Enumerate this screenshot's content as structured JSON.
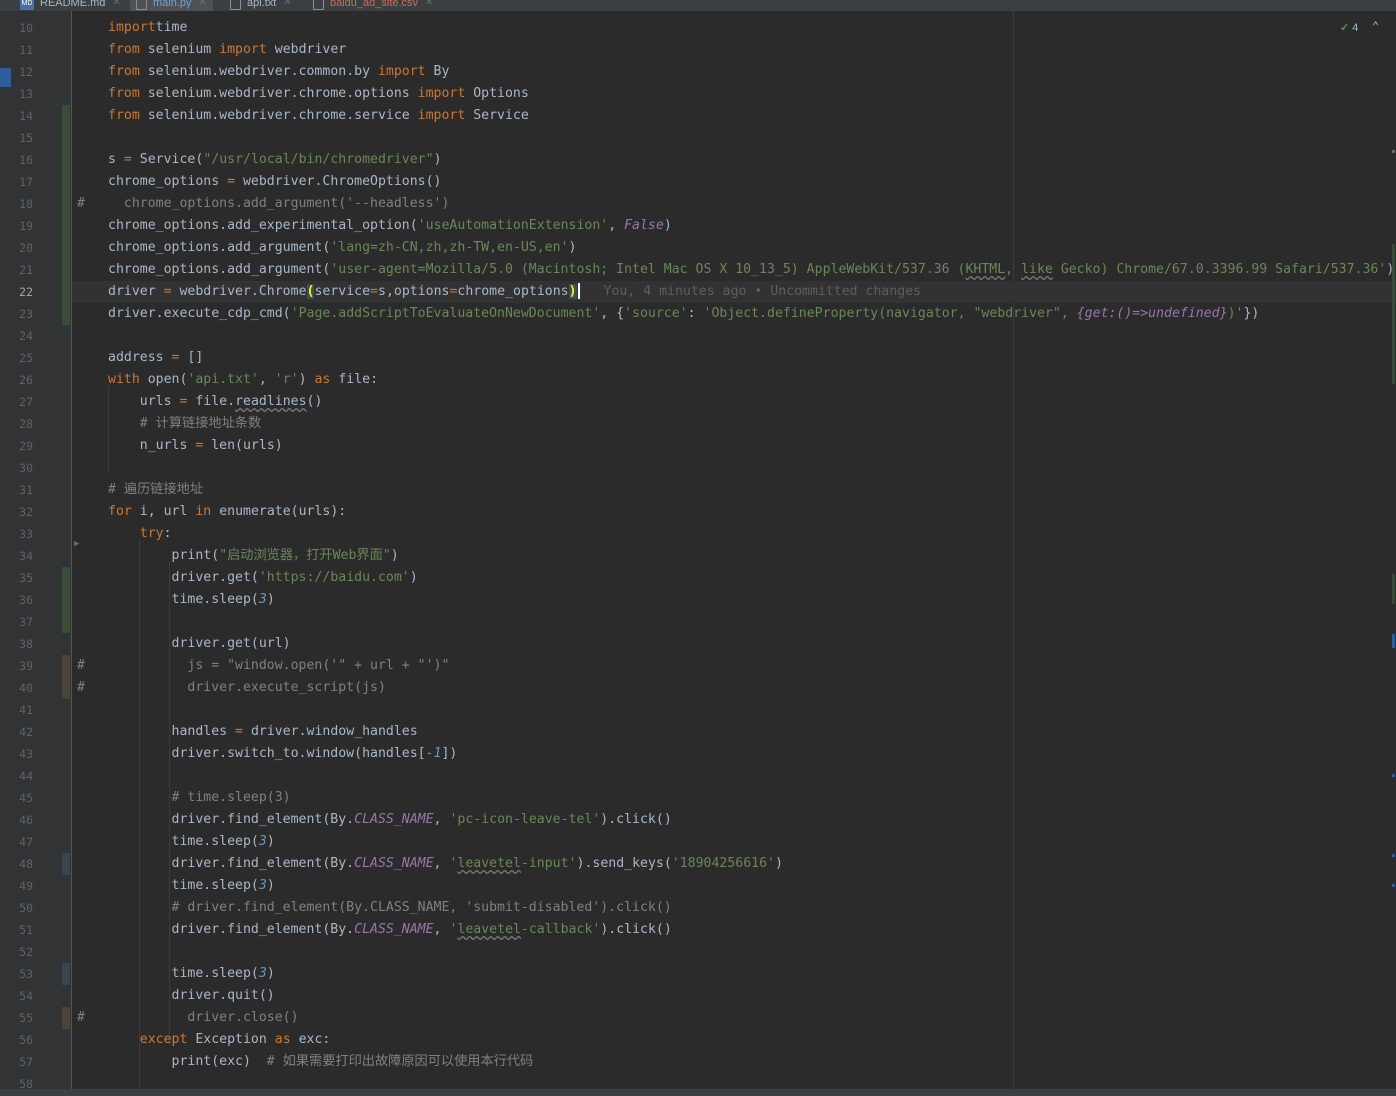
{
  "tabs": [
    {
      "label": "README.md",
      "icon": "markdown-file-icon",
      "active": false
    },
    {
      "label": "main.py",
      "icon": "python-file-icon",
      "active": true
    },
    {
      "label": "api.txt",
      "icon": "text-file-icon",
      "active": false
    },
    {
      "label": "baidu_ad_site.csv",
      "icon": "csv-file-icon",
      "active": false
    }
  ],
  "inspection": {
    "count": "4",
    "icon": "check-icon"
  },
  "blame_hint": "You, 4 minutes ago • Uncommitted changes",
  "lines": [
    {
      "n": "10",
      "parts": [
        [
          "k",
          "import"
        ],
        [
          "",
          "time"
        ]
      ]
    },
    {
      "n": "11",
      "parts": [
        [
          "k",
          "from"
        ],
        [
          "",
          " selenium "
        ],
        [
          "k",
          "import"
        ],
        [
          "",
          " webdriver"
        ]
      ]
    },
    {
      "n": "12",
      "parts": [
        [
          "k",
          "from"
        ],
        [
          "",
          " selenium.webdriver.common.by "
        ],
        [
          "k",
          "import"
        ],
        [
          "",
          " By"
        ]
      ]
    },
    {
      "n": "13",
      "parts": [
        [
          "k",
          "from"
        ],
        [
          "",
          " selenium.webdriver.chrome.options "
        ],
        [
          "k",
          "import"
        ],
        [
          "",
          " Options"
        ]
      ]
    },
    {
      "n": "14",
      "parts": [
        [
          "k",
          "from"
        ],
        [
          "",
          " selenium.webdriver.chrome.service "
        ],
        [
          "k",
          "import"
        ],
        [
          "",
          " Service"
        ]
      ]
    },
    {
      "n": "15",
      "parts": []
    },
    {
      "n": "16",
      "parts": [
        [
          "",
          "s "
        ],
        [
          "k",
          "="
        ],
        [
          "",
          " Service("
        ],
        [
          "s",
          "\"/usr/local/bin/chromedriver\""
        ],
        [
          "",
          ")"
        ]
      ]
    },
    {
      "n": "17",
      "parts": [
        [
          "",
          "chrome_options "
        ],
        [
          "k",
          "="
        ],
        [
          "",
          " webdriver.ChromeOptions()"
        ]
      ]
    },
    {
      "n": "18",
      "hash": true,
      "parts": [
        [
          "c",
          "  chrome_options.add_argument('--headless')"
        ]
      ]
    },
    {
      "n": "19",
      "parts": [
        [
          "",
          "chrome_options.add_experimental_option("
        ],
        [
          "s",
          "'useAutomationExtension'"
        ],
        [
          "",
          ", "
        ],
        [
          "it",
          "False"
        ],
        [
          "",
          ")"
        ]
      ]
    },
    {
      "n": "20",
      "parts": [
        [
          "",
          "chrome_options.add_argument("
        ],
        [
          "s",
          "'lang=zh-CN,zh,zh-TW,en-US,en'"
        ],
        [
          "",
          ")"
        ]
      ]
    },
    {
      "n": "21",
      "parts": [
        [
          "",
          "chrome_options.add_argument("
        ],
        [
          "s",
          "'user-agent=Mozilla/5.0 (Macintosh; Intel Mac OS X 10_13_5) AppleWebKit/537.36 ("
        ],
        [
          "sq",
          "KHTML"
        ],
        [
          "s",
          ", "
        ],
        [
          "sq",
          "like"
        ],
        [
          "s",
          " Gecko) Chrome/67.0.3396.99 Safari/537.36'"
        ],
        [
          "",
          ")"
        ]
      ]
    },
    {
      "n": "22",
      "current": true,
      "parts": [
        [
          "",
          "driver "
        ],
        [
          "k",
          "="
        ],
        [
          "",
          " webdriver.Chrome"
        ],
        [
          "brk",
          "("
        ],
        [
          "",
          "service"
        ],
        [
          "k",
          "="
        ],
        [
          "",
          "s,options"
        ],
        [
          "k",
          "="
        ],
        [
          "",
          "chrome_options"
        ],
        [
          "brk",
          ")"
        ]
      ]
    },
    {
      "n": "23",
      "parts": [
        [
          "",
          "driver.execute_cdp_cmd("
        ],
        [
          "s",
          "'Page.addScriptToEvaluateOnNewDocument'"
        ],
        [
          "",
          ", {"
        ],
        [
          "s",
          "'source'"
        ],
        [
          "",
          ": "
        ],
        [
          "s",
          "'Object.defineProperty(navigator, \"webdriver\", "
        ],
        [
          "it",
          "{get:()=>undefined}"
        ],
        [
          "s",
          ")'"
        ],
        [
          "",
          "})"
        ]
      ]
    },
    {
      "n": "24",
      "parts": []
    },
    {
      "n": "25",
      "parts": [
        [
          "",
          "address "
        ],
        [
          "k",
          "="
        ],
        [
          "",
          " []"
        ]
      ]
    },
    {
      "n": "26",
      "parts": [
        [
          "k",
          "with"
        ],
        [
          "",
          " open("
        ],
        [
          "s",
          "'api.txt'"
        ],
        [
          "",
          ", "
        ],
        [
          "s",
          "'r'"
        ],
        [
          "",
          ") "
        ],
        [
          "k",
          "as"
        ],
        [
          "",
          " file:"
        ]
      ]
    },
    {
      "n": "27",
      "parts": [
        [
          "",
          "    urls "
        ],
        [
          "k",
          "="
        ],
        [
          "",
          " file."
        ],
        [
          "q",
          "readlines"
        ],
        [
          "",
          "()"
        ]
      ]
    },
    {
      "n": "28",
      "parts": [
        [
          "c",
          "    # 计算链接地址条数"
        ]
      ]
    },
    {
      "n": "29",
      "parts": [
        [
          "",
          "    n_urls "
        ],
        [
          "k",
          "="
        ],
        [
          "",
          " len(urls)"
        ]
      ]
    },
    {
      "n": "30",
      "parts": []
    },
    {
      "n": "31",
      "parts": [
        [
          "c",
          "# 遍历链接地址"
        ]
      ]
    },
    {
      "n": "32",
      "parts": [
        [
          "k",
          "for"
        ],
        [
          "",
          " i, url "
        ],
        [
          "k",
          "in"
        ],
        [
          "",
          " enumerate(urls):"
        ]
      ]
    },
    {
      "n": "33",
      "parts": [
        [
          "",
          "    "
        ],
        [
          "k",
          "try"
        ],
        [
          "",
          ":"
        ]
      ]
    },
    {
      "n": "34",
      "parts": [
        [
          "",
          "        print("
        ],
        [
          "s",
          "\"启动浏览器，打开Web界面\""
        ],
        [
          "",
          ")"
        ]
      ]
    },
    {
      "n": "35",
      "parts": [
        [
          "",
          "        driver.get("
        ],
        [
          "s",
          "'https://baidu.com'"
        ],
        [
          "",
          ")"
        ]
      ]
    },
    {
      "n": "36",
      "parts": [
        [
          "",
          "        time.sleep("
        ],
        [
          "n",
          "3"
        ],
        [
          "",
          ")"
        ]
      ]
    },
    {
      "n": "37",
      "parts": []
    },
    {
      "n": "38",
      "parts": [
        [
          "",
          "        driver.get(url)"
        ]
      ]
    },
    {
      "n": "39",
      "hash": true,
      "parts": [
        [
          "c",
          "          js = \"window.open('\" + url + \"')\""
        ]
      ]
    },
    {
      "n": "40",
      "hash": true,
      "parts": [
        [
          "c",
          "          driver.execute_script(js)"
        ]
      ]
    },
    {
      "n": "41",
      "parts": []
    },
    {
      "n": "42",
      "parts": [
        [
          "",
          "        handles "
        ],
        [
          "k",
          "="
        ],
        [
          "",
          " driver.window_handles"
        ]
      ]
    },
    {
      "n": "43",
      "parts": [
        [
          "",
          "        driver.switch_to.window(handles["
        ],
        [
          "n",
          "-1"
        ],
        [
          "",
          "])"
        ]
      ]
    },
    {
      "n": "44",
      "parts": []
    },
    {
      "n": "45",
      "parts": [
        [
          "c",
          "        # time.sleep(3)"
        ]
      ]
    },
    {
      "n": "46",
      "parts": [
        [
          "",
          "        driver.find_element(By."
        ],
        [
          "it",
          "CLASS_NAME"
        ],
        [
          "",
          ", "
        ],
        [
          "s",
          "'pc-icon-leave-tel'"
        ],
        [
          "",
          ").click()"
        ]
      ]
    },
    {
      "n": "47",
      "parts": [
        [
          "",
          "        time.sleep("
        ],
        [
          "n",
          "3"
        ],
        [
          "",
          ")"
        ]
      ]
    },
    {
      "n": "48",
      "parts": [
        [
          "",
          "        driver.find_element(By."
        ],
        [
          "it",
          "CLASS_NAME"
        ],
        [
          "",
          ", "
        ],
        [
          "s",
          "'"
        ],
        [
          "sq",
          "leavetel"
        ],
        [
          "s",
          "-input'"
        ],
        [
          "",
          ").send_keys("
        ],
        [
          "s",
          "'18904256616'"
        ],
        [
          "",
          ")"
        ]
      ]
    },
    {
      "n": "49",
      "parts": [
        [
          "",
          "        time.sleep("
        ],
        [
          "n",
          "3"
        ],
        [
          "",
          ")"
        ]
      ]
    },
    {
      "n": "50",
      "parts": [
        [
          "c",
          "        # driver.find_element(By.CLASS_NAME, 'submit-disabled').click()"
        ]
      ]
    },
    {
      "n": "51",
      "parts": [
        [
          "",
          "        driver.find_element(By."
        ],
        [
          "it",
          "CLASS_NAME"
        ],
        [
          "",
          ", "
        ],
        [
          "s",
          "'"
        ],
        [
          "sq",
          "leavetel"
        ],
        [
          "s",
          "-callback'"
        ],
        [
          "",
          ").click()"
        ]
      ]
    },
    {
      "n": "52",
      "parts": []
    },
    {
      "n": "53",
      "parts": [
        [
          "",
          "        time.sleep("
        ],
        [
          "n",
          "3"
        ],
        [
          "",
          ")"
        ]
      ]
    },
    {
      "n": "54",
      "parts": [
        [
          "",
          "        driver.quit()"
        ]
      ]
    },
    {
      "n": "55",
      "hash": true,
      "parts": [
        [
          "c",
          "          driver.close()"
        ]
      ]
    },
    {
      "n": "56",
      "parts": [
        [
          "",
          "    "
        ],
        [
          "k",
          "except"
        ],
        [
          "",
          " Exception "
        ],
        [
          "k",
          "as"
        ],
        [
          "",
          " exc:"
        ]
      ]
    },
    {
      "n": "57",
      "parts": [
        [
          "",
          "        print(exc)  "
        ],
        [
          "c",
          "# 如果需要打印出故障原因可以使用本行代码"
        ]
      ]
    },
    {
      "n": "58",
      "parts": []
    }
  ],
  "change_markers": [
    {
      "type": "add",
      "from": "14",
      "to": "23"
    },
    {
      "type": "add",
      "from": "35",
      "to": "37"
    },
    {
      "type": "cmt",
      "from": "39",
      "to": "40"
    },
    {
      "type": "mod",
      "from": "48",
      "to": "48"
    },
    {
      "type": "mod",
      "from": "53",
      "to": "53"
    },
    {
      "type": "cmt",
      "from": "55",
      "to": "55"
    }
  ]
}
